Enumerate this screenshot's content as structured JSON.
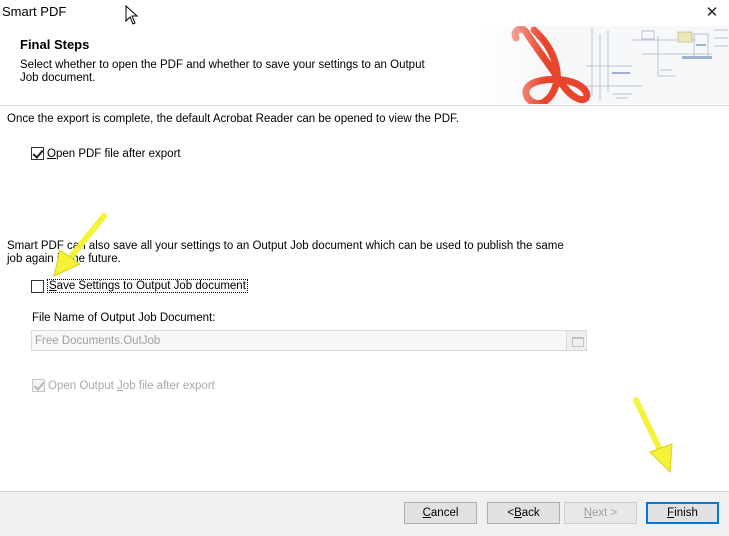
{
  "window": {
    "title": "Smart PDF",
    "close_glyph": "✕"
  },
  "header": {
    "title": "Final Steps",
    "description": "Select whether to open the PDF and whether to save your settings to an Output Job document."
  },
  "intro_text": "Once the export is complete, the default Acrobat Reader can be opened to view the PDF.",
  "open_pdf": {
    "accel": "O",
    "rest": "pen PDF file after export",
    "checked": true
  },
  "outjob_text": "Smart PDF can also save all your settings to an Output Job document which can be used to publish the same job again in the future.",
  "save_settings": {
    "accel": "S",
    "rest": "ave Settings to Output Job document",
    "checked": false
  },
  "file_name": {
    "label": "File Name of Output Job Document:",
    "value": "Free Documents.OutJob"
  },
  "open_outjob": {
    "pre": "Open Output ",
    "accel": "J",
    "rest": "ob file after export",
    "checked": true,
    "enabled": false
  },
  "buttons": {
    "cancel": {
      "accel": "C",
      "rest": "ancel"
    },
    "back": {
      "pre": "< ",
      "accel": "B",
      "rest": "ack"
    },
    "next": {
      "accel": "N",
      "rest": "ext >"
    },
    "finish": {
      "accel": "F",
      "rest": "inish"
    }
  },
  "colors": {
    "accent": "#0078d7",
    "adobe_red": "#e8452c",
    "annotation_arrow": "#f5f23a"
  },
  "icons": [
    "close-icon",
    "adobe-pdf-logo-icon",
    "mouse-cursor-icon",
    "annotation-arrow-icon"
  ]
}
